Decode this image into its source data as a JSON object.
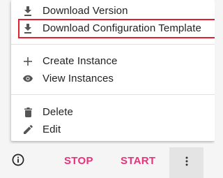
{
  "menu": {
    "items": [
      {
        "label": "Download Version",
        "icon": "download-icon"
      },
      {
        "label": "Download Configuration Template",
        "icon": "download-icon"
      },
      {
        "label": "Create Instance",
        "icon": "plus-icon"
      },
      {
        "label": "View Instances",
        "icon": "eye-icon"
      },
      {
        "label": "Delete",
        "icon": "trash-icon"
      },
      {
        "label": "Edit",
        "icon": "pencil-icon"
      }
    ],
    "highlight_color": "#e0202a"
  },
  "actions": {
    "info_icon": "info-icon",
    "stop_label": "STOP",
    "start_label": "START",
    "more_icon": "more-vertical-icon",
    "accent_color": "#e8327a"
  }
}
